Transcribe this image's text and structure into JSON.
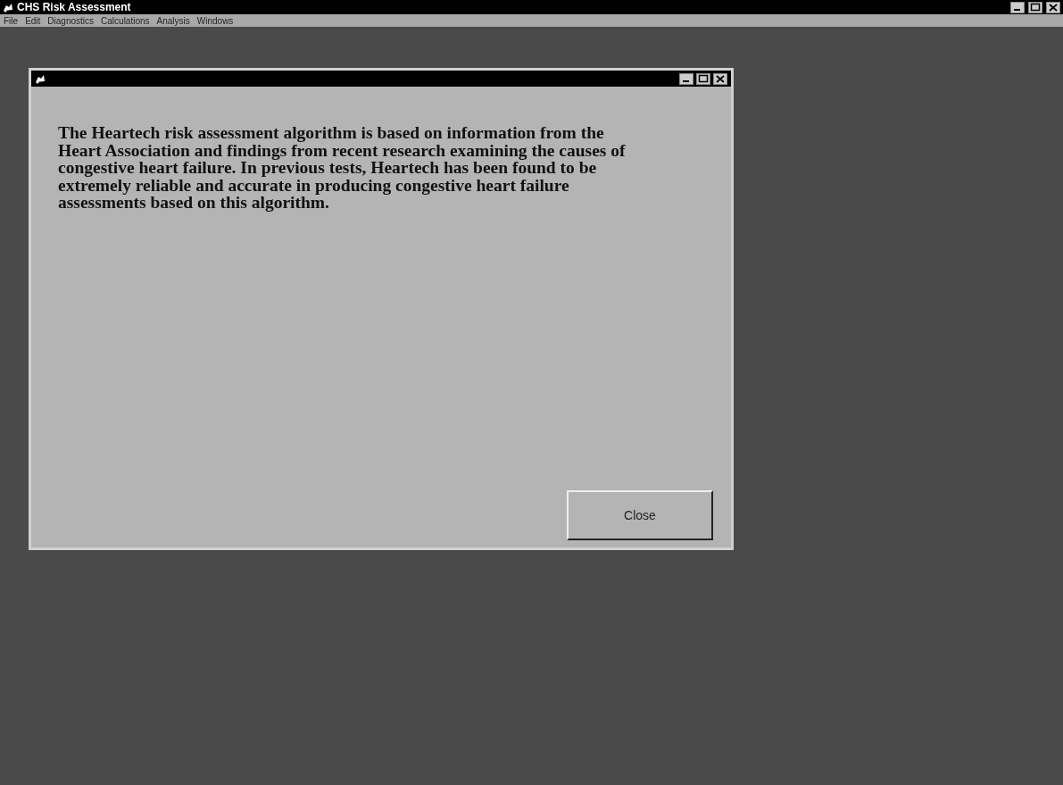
{
  "window": {
    "title": "CHS Risk Assessment"
  },
  "menu": [
    "File",
    "Edit",
    "Diagnostics",
    "Calculations",
    "Analysis",
    "Windows"
  ],
  "dialog": {
    "message": "The Heartech risk assessment algorithm is based on information from the Heart Association and findings from recent research examining the causes of congestive heart failure.  In previous tests, Heartech has been found to be extremely reliable and accurate in producing congestive heart failure assessments based on this algorithm.",
    "button": "Close"
  }
}
